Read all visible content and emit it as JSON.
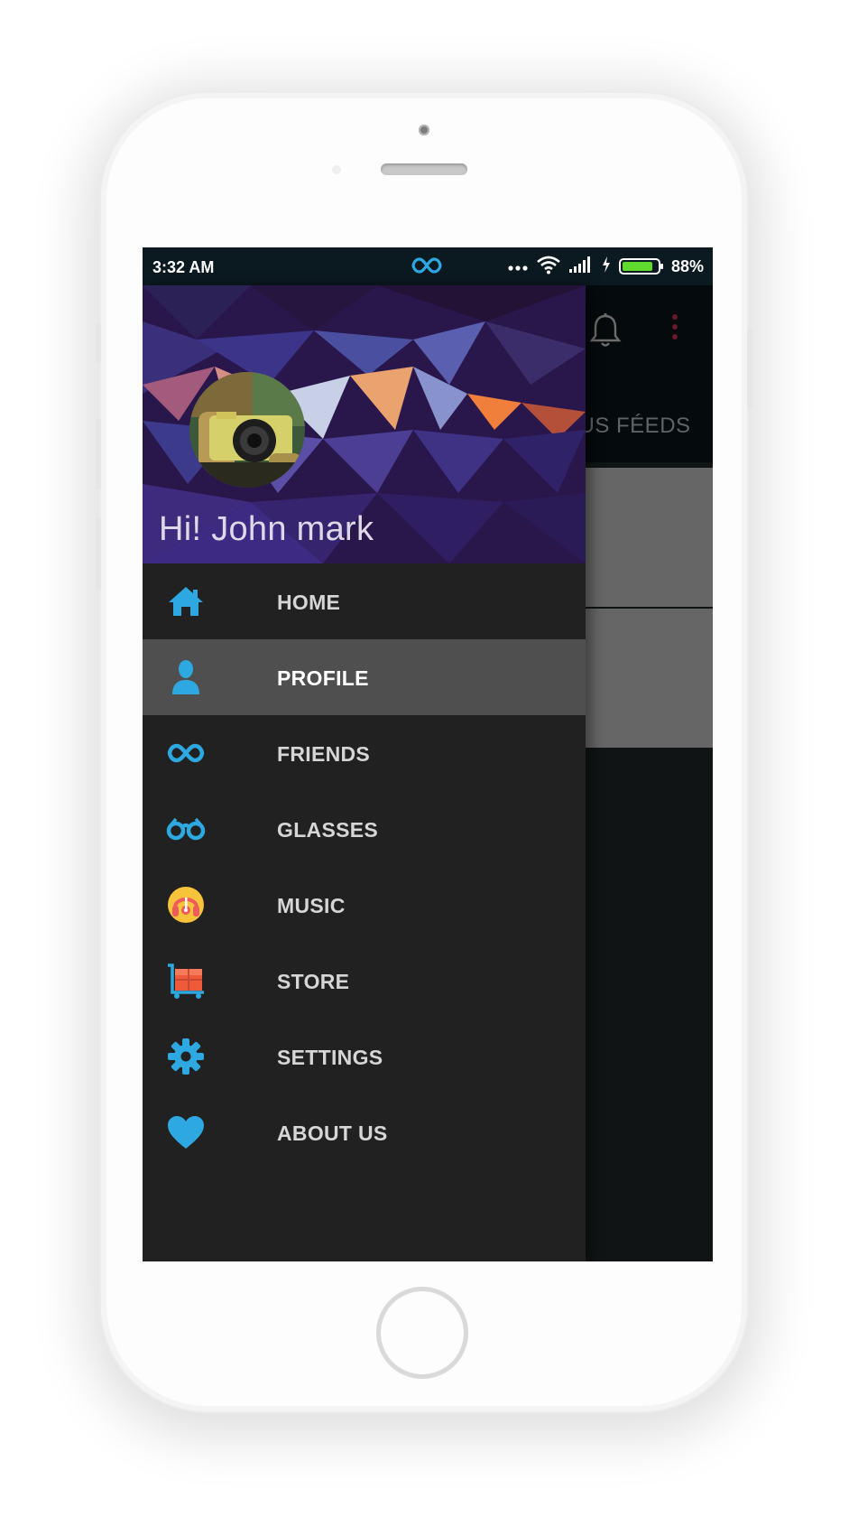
{
  "status_bar": {
    "time": "3:32 AM",
    "battery_percent": "88%",
    "battery_level": 0.88,
    "icons": [
      "infinity-icon",
      "more-dots-icon",
      "wifi-icon",
      "signal-icon",
      "charging-icon",
      "battery-icon"
    ]
  },
  "background_app": {
    "tab_label": "AMPUS FÉEDS",
    "toolbar_icons": [
      "bell-icon",
      "more-vert-icon"
    ]
  },
  "drawer": {
    "greeting": "Hi! John mark",
    "avatar_icon": "camera-photo-avatar",
    "menu": [
      {
        "label": "HOME",
        "icon": "home-icon",
        "active": false
      },
      {
        "label": "PROFILE",
        "icon": "person-icon",
        "active": true
      },
      {
        "label": "FRIENDS",
        "icon": "infinity-icon",
        "active": false
      },
      {
        "label": "GLASSES",
        "icon": "glasses-icon",
        "active": false
      },
      {
        "label": "MUSIC",
        "icon": "music-headphones-icon",
        "active": false
      },
      {
        "label": "STORE",
        "icon": "cart-icon",
        "active": false
      },
      {
        "label": "SETTINGS",
        "icon": "gear-icon",
        "active": false
      },
      {
        "label": "ABOUT US",
        "icon": "heart-icon",
        "active": false
      }
    ]
  },
  "colors": {
    "accent": "#2ea8e0",
    "drawer_bg": "#212121",
    "active_item_bg": "#4f4f4f",
    "status_bar_bg": "#0b1920",
    "battery_green": "#5fdb2f"
  }
}
